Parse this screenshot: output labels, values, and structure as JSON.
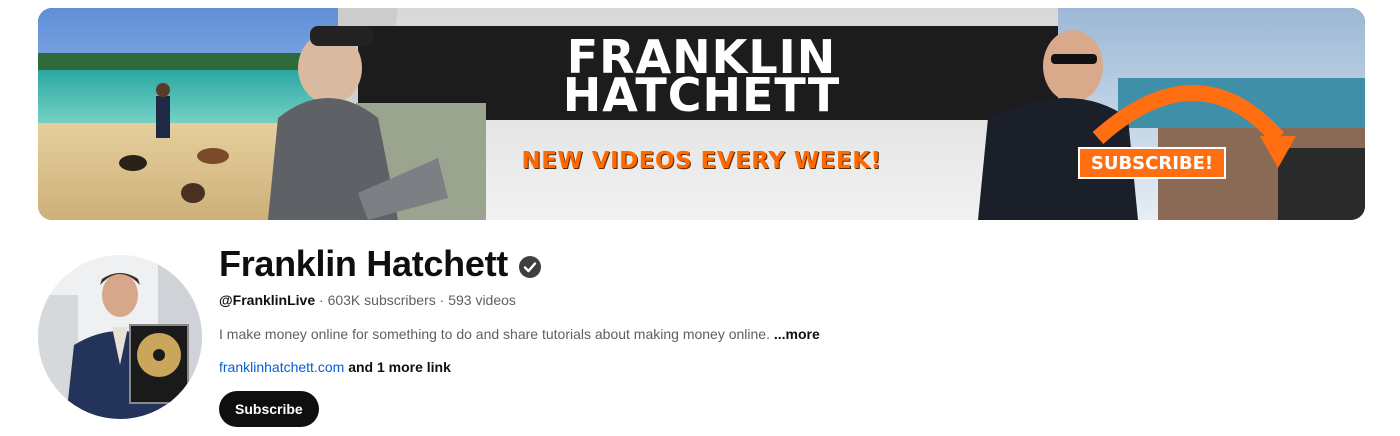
{
  "banner": {
    "title_line1": "FRANKLIN",
    "title_line2": "HATCHETT",
    "tagline": "NEW VIDEOS EVERY WEEK!",
    "subscribe_label": "SUBSCRIBE!"
  },
  "channel": {
    "name": "Franklin Hatchett",
    "verified_icon": "verified-check-icon",
    "handle": "@FranklinLive",
    "separator": " · ",
    "subscribers": "603K subscribers",
    "videos": "593 videos",
    "description": "I make money online for something to do and share tutorials about making money online.",
    "more_label": "...more",
    "link_primary": "franklinhatchett.com",
    "link_more": "and 1 more link",
    "subscribe_label": "Subscribe"
  },
  "colors": {
    "accent_orange": "#ff6f12",
    "link_blue": "#065fd4",
    "button_dark": "#0f0f0f"
  }
}
